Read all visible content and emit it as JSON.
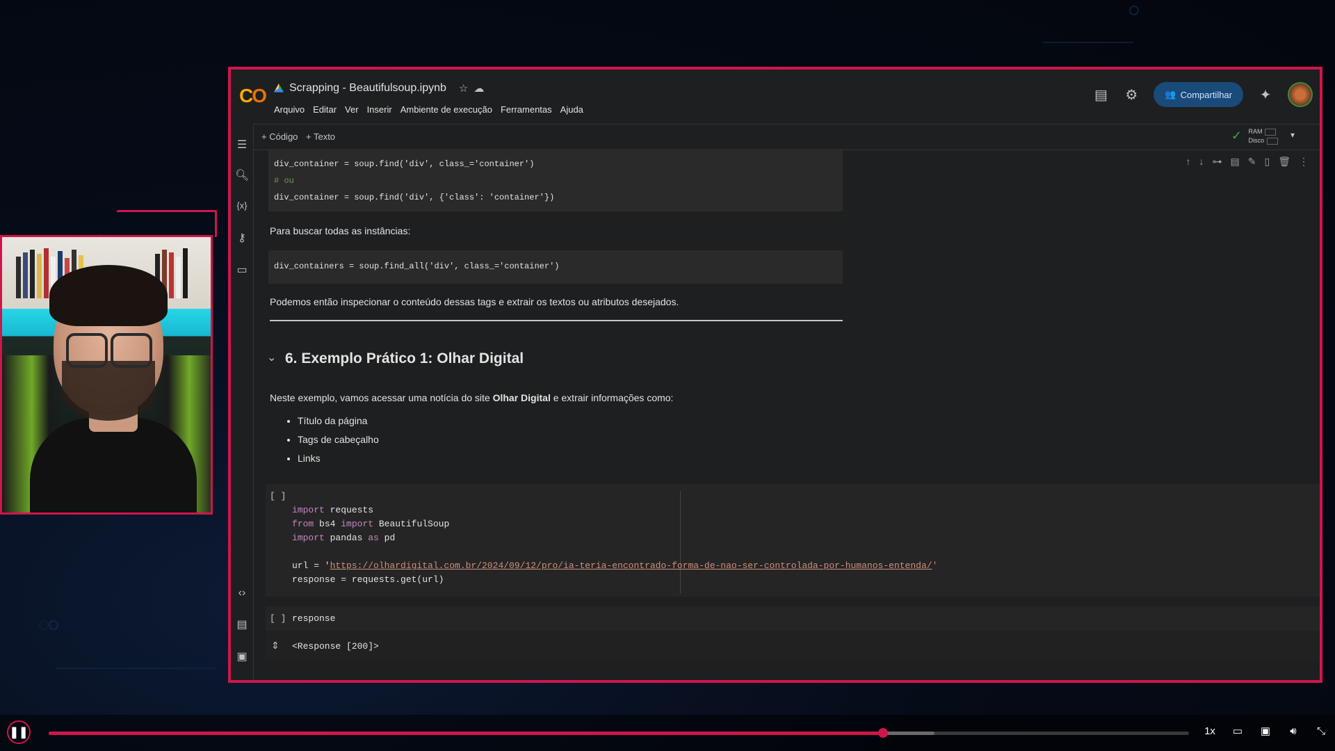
{
  "notebook": {
    "title": "Scrapping - Beautifulsoup.ipynb",
    "menu": [
      "Arquivo",
      "Editar",
      "Ver",
      "Inserir",
      "Ambiente de execução",
      "Ferramentas",
      "Ajuda"
    ],
    "share_label": "Compartilhar",
    "add_code": "+ Código",
    "add_text": "+ Texto",
    "ram_label": "RAM",
    "disk_label": "Disco"
  },
  "cells": {
    "code1_line1": "div_container = soup.find('div', class_='container')",
    "code1_line2": "# ou",
    "code1_line3": "div_container = soup.find('div', {'class': 'container'})",
    "md1": "Para buscar todas as instâncias:",
    "code2": "div_containers = soup.find_all('div', class_='container')",
    "md2": "Podemos então inspecionar o conteúdo dessas tags e extrair os textos ou atributos desejados.",
    "section_heading": "6. Exemplo Prático 1: Olhar Digital",
    "intro_prefix": "Neste exemplo, vamos acessar uma notícia do site ",
    "intro_bold": "Olhar Digital",
    "intro_suffix": " e extrair informações como:",
    "bullets": [
      "Título da página",
      "Tags de cabeçalho",
      "Links"
    ],
    "bracket": "[ ]",
    "code3": {
      "l1_kw": "import",
      "l1_rest": " requests",
      "l2_kw1": "from",
      "l2_mid": " bs4 ",
      "l2_kw2": "import",
      "l2_rest": " BeautifulSoup",
      "l3_kw1": "import",
      "l3_mid": " pandas ",
      "l3_kw2": "as",
      "l3_rest": " pd",
      "l5_pre": "url = '",
      "l5_url": "https://olhardigital.com.br/2024/09/12/pro/ia-teria-encontrado-forma-de-nao-ser-controlada-por-humanos-entenda/",
      "l5_post": "'",
      "l6": "response = requests.get(url)"
    },
    "code4": "response",
    "output4": "<Response [200]>"
  },
  "player": {
    "speed": "1x",
    "progress_fraction": 0.732,
    "buffer_fraction": 0.777
  },
  "colors": {
    "accent": "#d0154d",
    "colab_bg": "#1e1f20",
    "share_bg": "#1a4a7a"
  },
  "icons": [
    "toc-icon",
    "find-icon",
    "variables-icon",
    "key-icon",
    "folder-icon",
    "code-snippets-icon",
    "command-palette-icon",
    "terminal-icon",
    "star-icon",
    "cloud-icon",
    "comments-icon",
    "settings-icon",
    "gemini-icon",
    "pause-icon",
    "captions-icon",
    "pip-icon",
    "volume-icon",
    "fullscreen-exit-icon"
  ]
}
